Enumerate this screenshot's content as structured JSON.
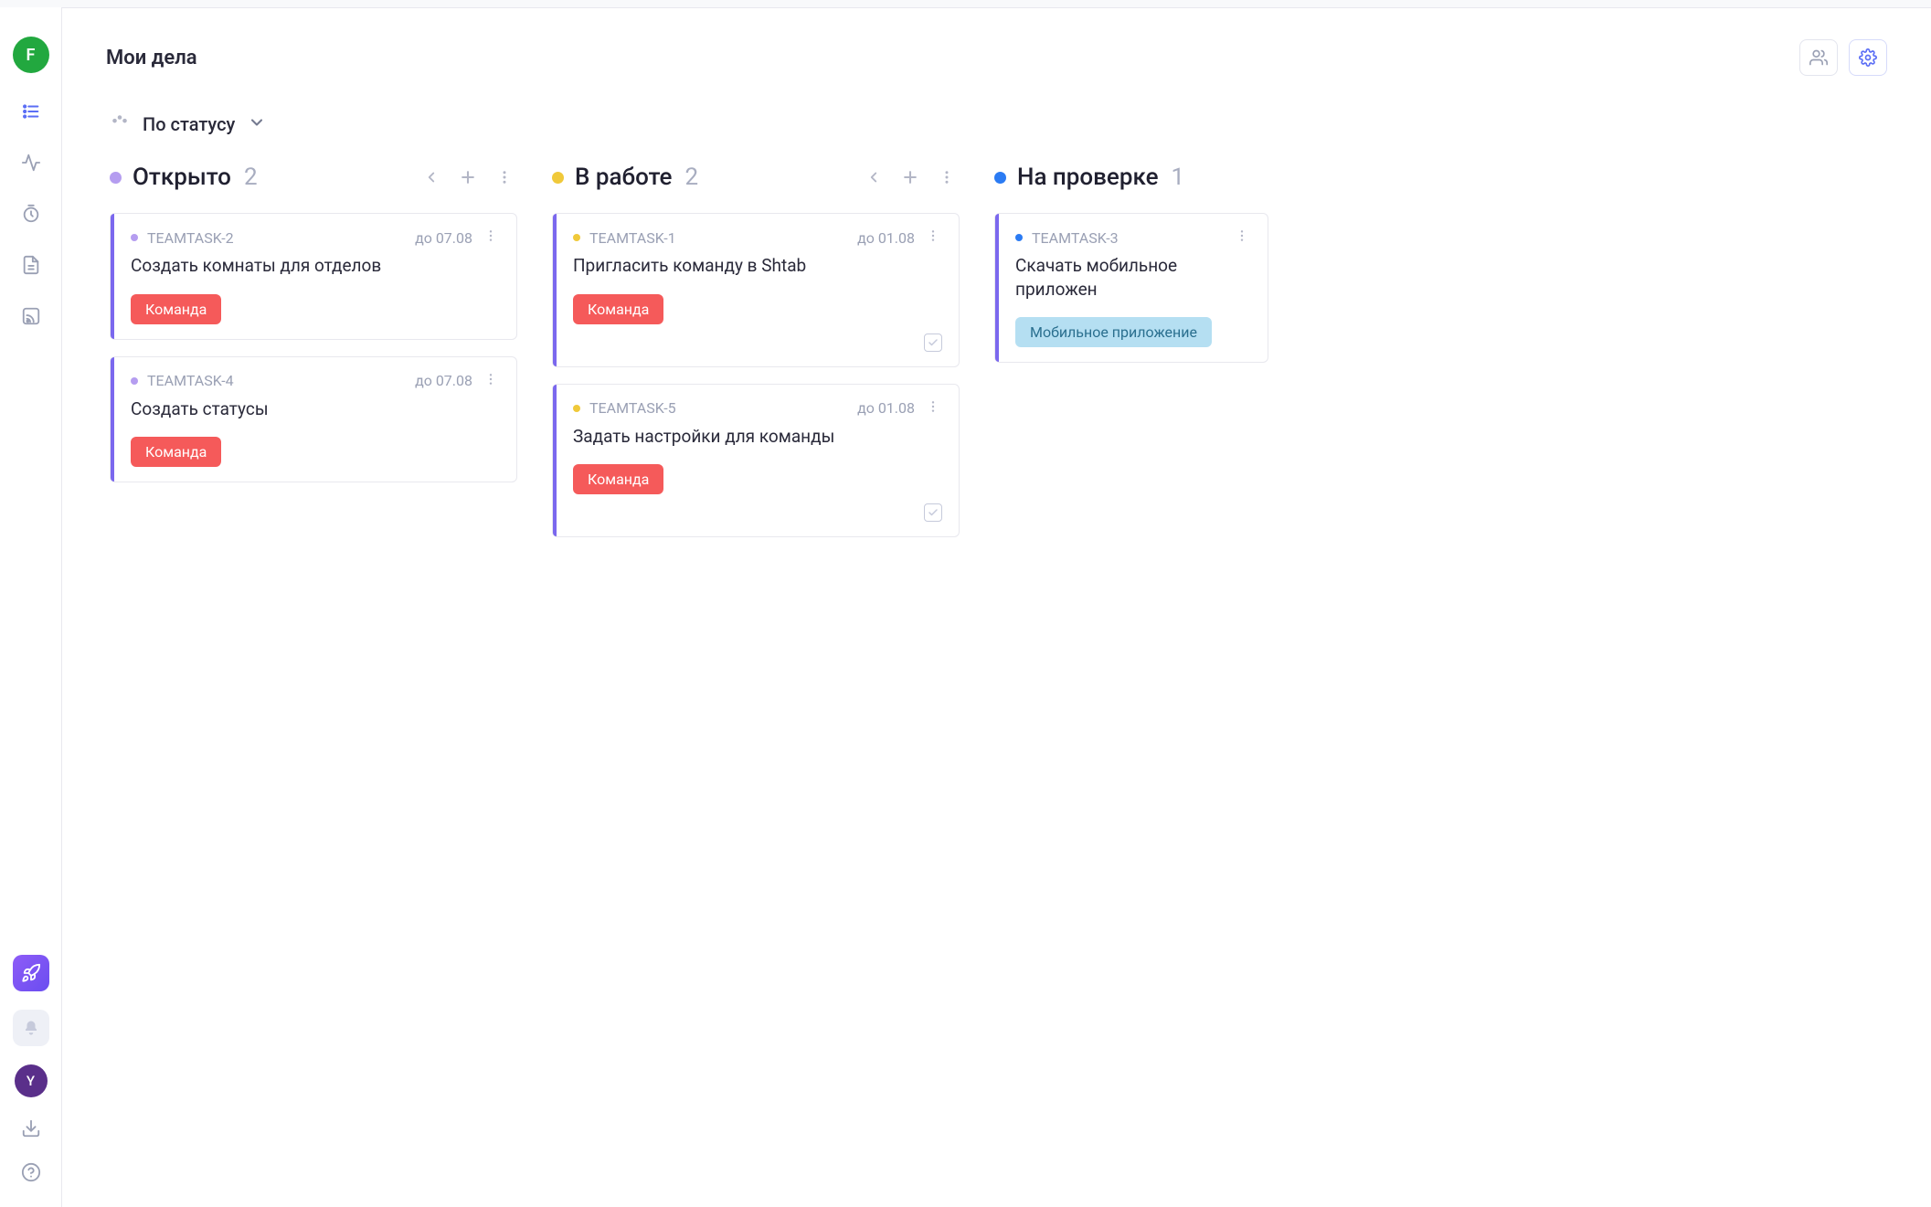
{
  "sidebar": {
    "avatar_top": "F",
    "avatar_bottom": "Y"
  },
  "header": {
    "title": "Мои дела"
  },
  "grouping": {
    "label": "По статусу"
  },
  "columns": [
    {
      "title": "Открыто",
      "count": "2",
      "dot_color": "#b59df0",
      "show_controls": true,
      "cards": [
        {
          "dot_color": "#b59df0",
          "task_id": "TEAMTASK-2",
          "due": "до 07.08",
          "title": "Создать комнаты для отделов",
          "tag": "Команда",
          "tag_class": "tag-red",
          "has_subtask_indicator": false
        },
        {
          "dot_color": "#b59df0",
          "task_id": "TEAMTASK-4",
          "due": "до 07.08",
          "title": "Создать статусы",
          "tag": "Команда",
          "tag_class": "tag-red",
          "has_subtask_indicator": false
        }
      ]
    },
    {
      "title": "В работе",
      "count": "2",
      "dot_color": "#f0c93a",
      "show_controls": true,
      "cards": [
        {
          "dot_color": "#f0c93a",
          "task_id": "TEAMTASK-1",
          "due": "до 01.08",
          "title": "Пригласить команду в Shtab",
          "tag": "Команда",
          "tag_class": "tag-red",
          "has_subtask_indicator": true
        },
        {
          "dot_color": "#f0c93a",
          "task_id": "TEAMTASK-5",
          "due": "до 01.08",
          "title": "Задать настройки для команды",
          "tag": "Команда",
          "tag_class": "tag-red",
          "has_subtask_indicator": true
        }
      ]
    },
    {
      "title": "На проверке",
      "count": "1",
      "dot_color": "#2b7bf3",
      "show_controls": false,
      "narrow": true,
      "cards": [
        {
          "dot_color": "#2b7bf3",
          "task_id": "TEAMTASK-3",
          "due": "",
          "title": "Скачать мобильное приложен",
          "tag": "Мобильное приложение",
          "tag_class": "tag-blue",
          "has_subtask_indicator": false
        }
      ]
    }
  ]
}
